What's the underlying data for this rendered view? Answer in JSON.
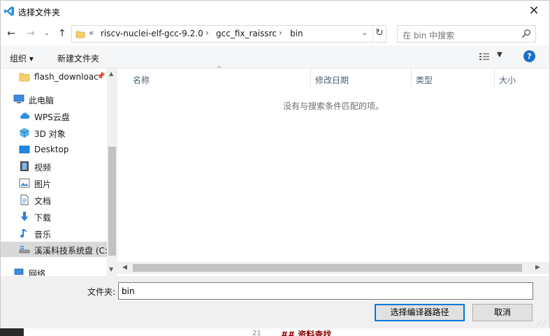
{
  "window": {
    "title": "选择文件夹",
    "close_glyph": "✕"
  },
  "address": {
    "prefix": "«",
    "crumbs": [
      "riscv-nuclei-elf-gcc-9.2.0",
      "gcc_fix_raissrc",
      "bin"
    ],
    "separator": "›"
  },
  "search": {
    "placeholder": "在 bin 中搜索"
  },
  "toolbar": {
    "organize": "组织 ▾",
    "new_folder": "新建文件夹",
    "help": "?"
  },
  "nav_tree": [
    {
      "label": "flash_downloac",
      "icon": "folder-icon"
    },
    {
      "label": "此电脑",
      "icon": "computer-icon"
    },
    {
      "label": "WPS云盘",
      "icon": "cloud-icon"
    },
    {
      "label": "3D 对象",
      "icon": "cube-icon"
    },
    {
      "label": "Desktop",
      "icon": "desktop-icon"
    },
    {
      "label": "视频",
      "icon": "video-icon"
    },
    {
      "label": "图片",
      "icon": "picture-icon"
    },
    {
      "label": "文档",
      "icon": "document-icon"
    },
    {
      "label": "下载",
      "icon": "download-icon"
    },
    {
      "label": "音乐",
      "icon": "music-icon"
    },
    {
      "label": "溪溪科技系统盘 (C:",
      "icon": "drive-icon"
    },
    {
      "label": "网络",
      "icon": "network-icon"
    }
  ],
  "columns": [
    "名称",
    "修改日期",
    "类型",
    "大小"
  ],
  "empty_message": "没有与搜索条件匹配的项。",
  "footer": {
    "filename_label": "文件夹:",
    "filename_value": "bin",
    "select_button": "选择编译器路径",
    "cancel_button": "取消"
  },
  "background": {
    "line_number": "21",
    "heading": "## 资料查找"
  },
  "colors": {
    "accent": "#0078d7",
    "help": "#1a6fc9",
    "selection": "#cce8ff"
  }
}
